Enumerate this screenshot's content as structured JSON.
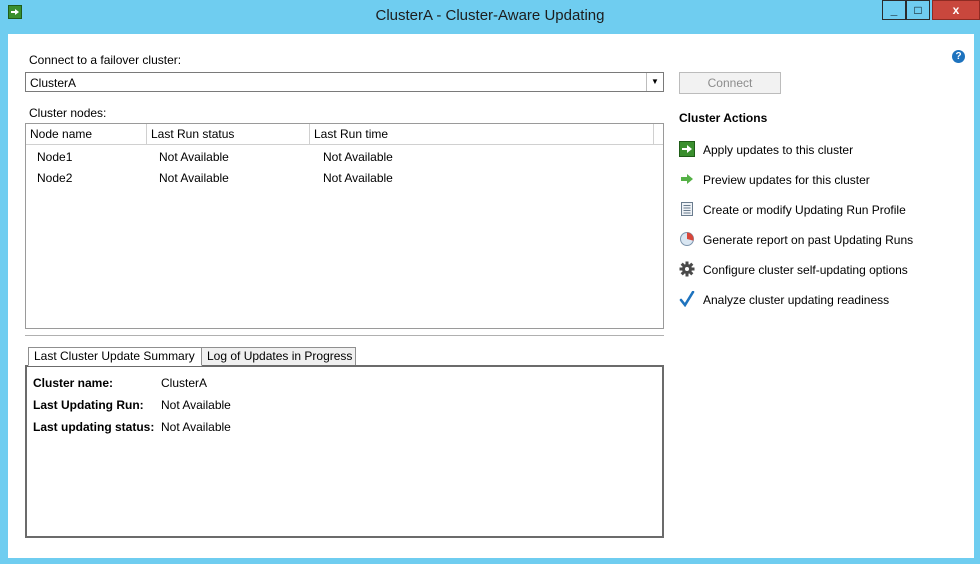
{
  "window": {
    "title": "ClusterA - Cluster-Aware Updating",
    "min_label": "_",
    "max_label": "□",
    "close_label": "x"
  },
  "connect": {
    "label": "Connect to a failover cluster:",
    "value": "ClusterA",
    "button_label": "Connect"
  },
  "nodes": {
    "label": "Cluster nodes:",
    "columns": [
      "Node name",
      "Last Run status",
      "Last Run time"
    ],
    "rows": [
      [
        "Node1",
        "Not Available",
        "Not Available"
      ],
      [
        "Node2",
        "Not Available",
        "Not Available"
      ]
    ]
  },
  "actions": {
    "title": "Cluster Actions",
    "items": [
      {
        "label": "Apply updates to this cluster",
        "icon": "apply-updates-icon"
      },
      {
        "label": "Preview updates for this cluster",
        "icon": "preview-arrow-icon"
      },
      {
        "label": "Create or modify Updating Run Profile",
        "icon": "profile-document-icon"
      },
      {
        "label": "Generate report on past Updating Runs",
        "icon": "report-chart-icon"
      },
      {
        "label": "Configure cluster self-updating options",
        "icon": "gear-icon"
      },
      {
        "label": "Analyze cluster updating readiness",
        "icon": "checkmark-icon"
      }
    ]
  },
  "tabs": [
    "Last Cluster Update Summary",
    "Log of Updates in Progress"
  ],
  "summary": [
    {
      "label": "Cluster name:",
      "value": "ClusterA"
    },
    {
      "label": "Last Updating Run:",
      "value": "Not Available"
    },
    {
      "label": "Last updating status:",
      "value": "Not Available"
    }
  ],
  "colors": {
    "titlebar": "#6fcdf0",
    "close_button": "#c9473d",
    "apply_green": "#3a8f2e",
    "check_blue": "#1e73be"
  }
}
